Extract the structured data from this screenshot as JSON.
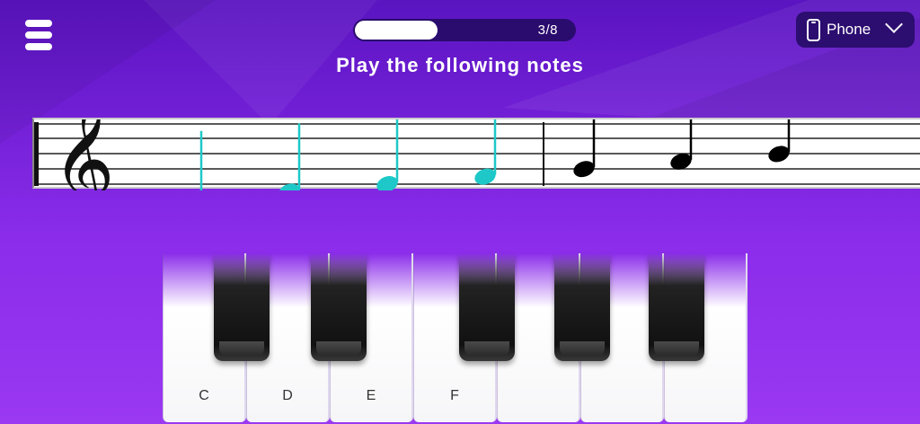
{
  "header": {
    "menu_icon": "menu-icon",
    "progress": {
      "current": 3,
      "total": 8,
      "label": "3/8",
      "fraction": 0.375
    },
    "device": {
      "icon": "phone-icon",
      "label": "Phone",
      "chevron": "chevron-down-icon"
    }
  },
  "instruction": "Play the following notes",
  "staff": {
    "clef": "treble-clef",
    "notes": [
      {
        "pitch": "C4",
        "state": "played"
      },
      {
        "pitch": "D4",
        "state": "played"
      },
      {
        "pitch": "E4",
        "state": "played"
      },
      {
        "pitch": "F4",
        "state": "played"
      },
      {
        "pitch": "G4",
        "state": "pending"
      },
      {
        "pitch": "A4",
        "state": "pending"
      },
      {
        "pitch": "B4",
        "state": "pending"
      }
    ],
    "played_color": "#1ec8c8",
    "pending_color": "#000000"
  },
  "keyboard": {
    "white_keys": [
      "C",
      "D",
      "E",
      "F",
      "",
      "",
      ""
    ],
    "black_key_count": 5
  },
  "colors": {
    "background": "#7a22d8",
    "progress_track": "#2a0b6e",
    "progress_fill": "#ffffff"
  }
}
